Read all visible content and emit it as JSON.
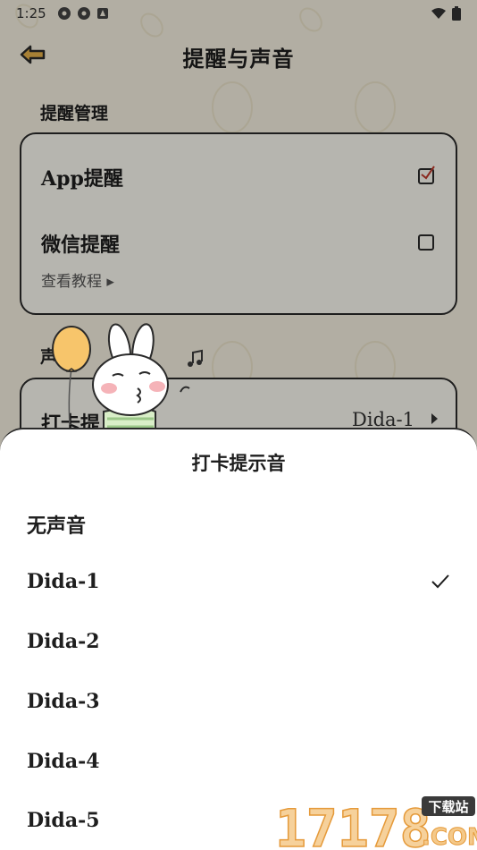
{
  "status_bar": {
    "time": "1:25",
    "left_icons": [
      "settings-icon",
      "settings-icon",
      "notification-icon"
    ],
    "right_icons": [
      "wifi-icon",
      "battery-icon"
    ]
  },
  "header": {
    "back_icon": "arrow-left-icon",
    "title": "提醒与声音"
  },
  "reminder_section": {
    "title": "提醒管理",
    "items": [
      {
        "label": "App提醒",
        "checked": true
      },
      {
        "label": "微信提醒",
        "checked": false
      }
    ],
    "tutorial_link": "查看教程 ▸"
  },
  "sound_section": {
    "title_visible": "声  置",
    "item_label_visible": "打卡提",
    "item_value": "Dida-1"
  },
  "sheet": {
    "title": "打卡提示音",
    "selected": "Dida-1",
    "options": [
      "无声音",
      "Dida-1",
      "Dida-2",
      "Dida-3",
      "Dida-4",
      "Dida-5"
    ]
  },
  "watermark": {
    "number": "17178",
    "badge": "下载站",
    "domain": ".COM"
  },
  "colors": {
    "background": "#f7f2e2",
    "border": "#2a2a2a",
    "check_accent": "#c0392b",
    "balloon": "#f7c56b"
  }
}
